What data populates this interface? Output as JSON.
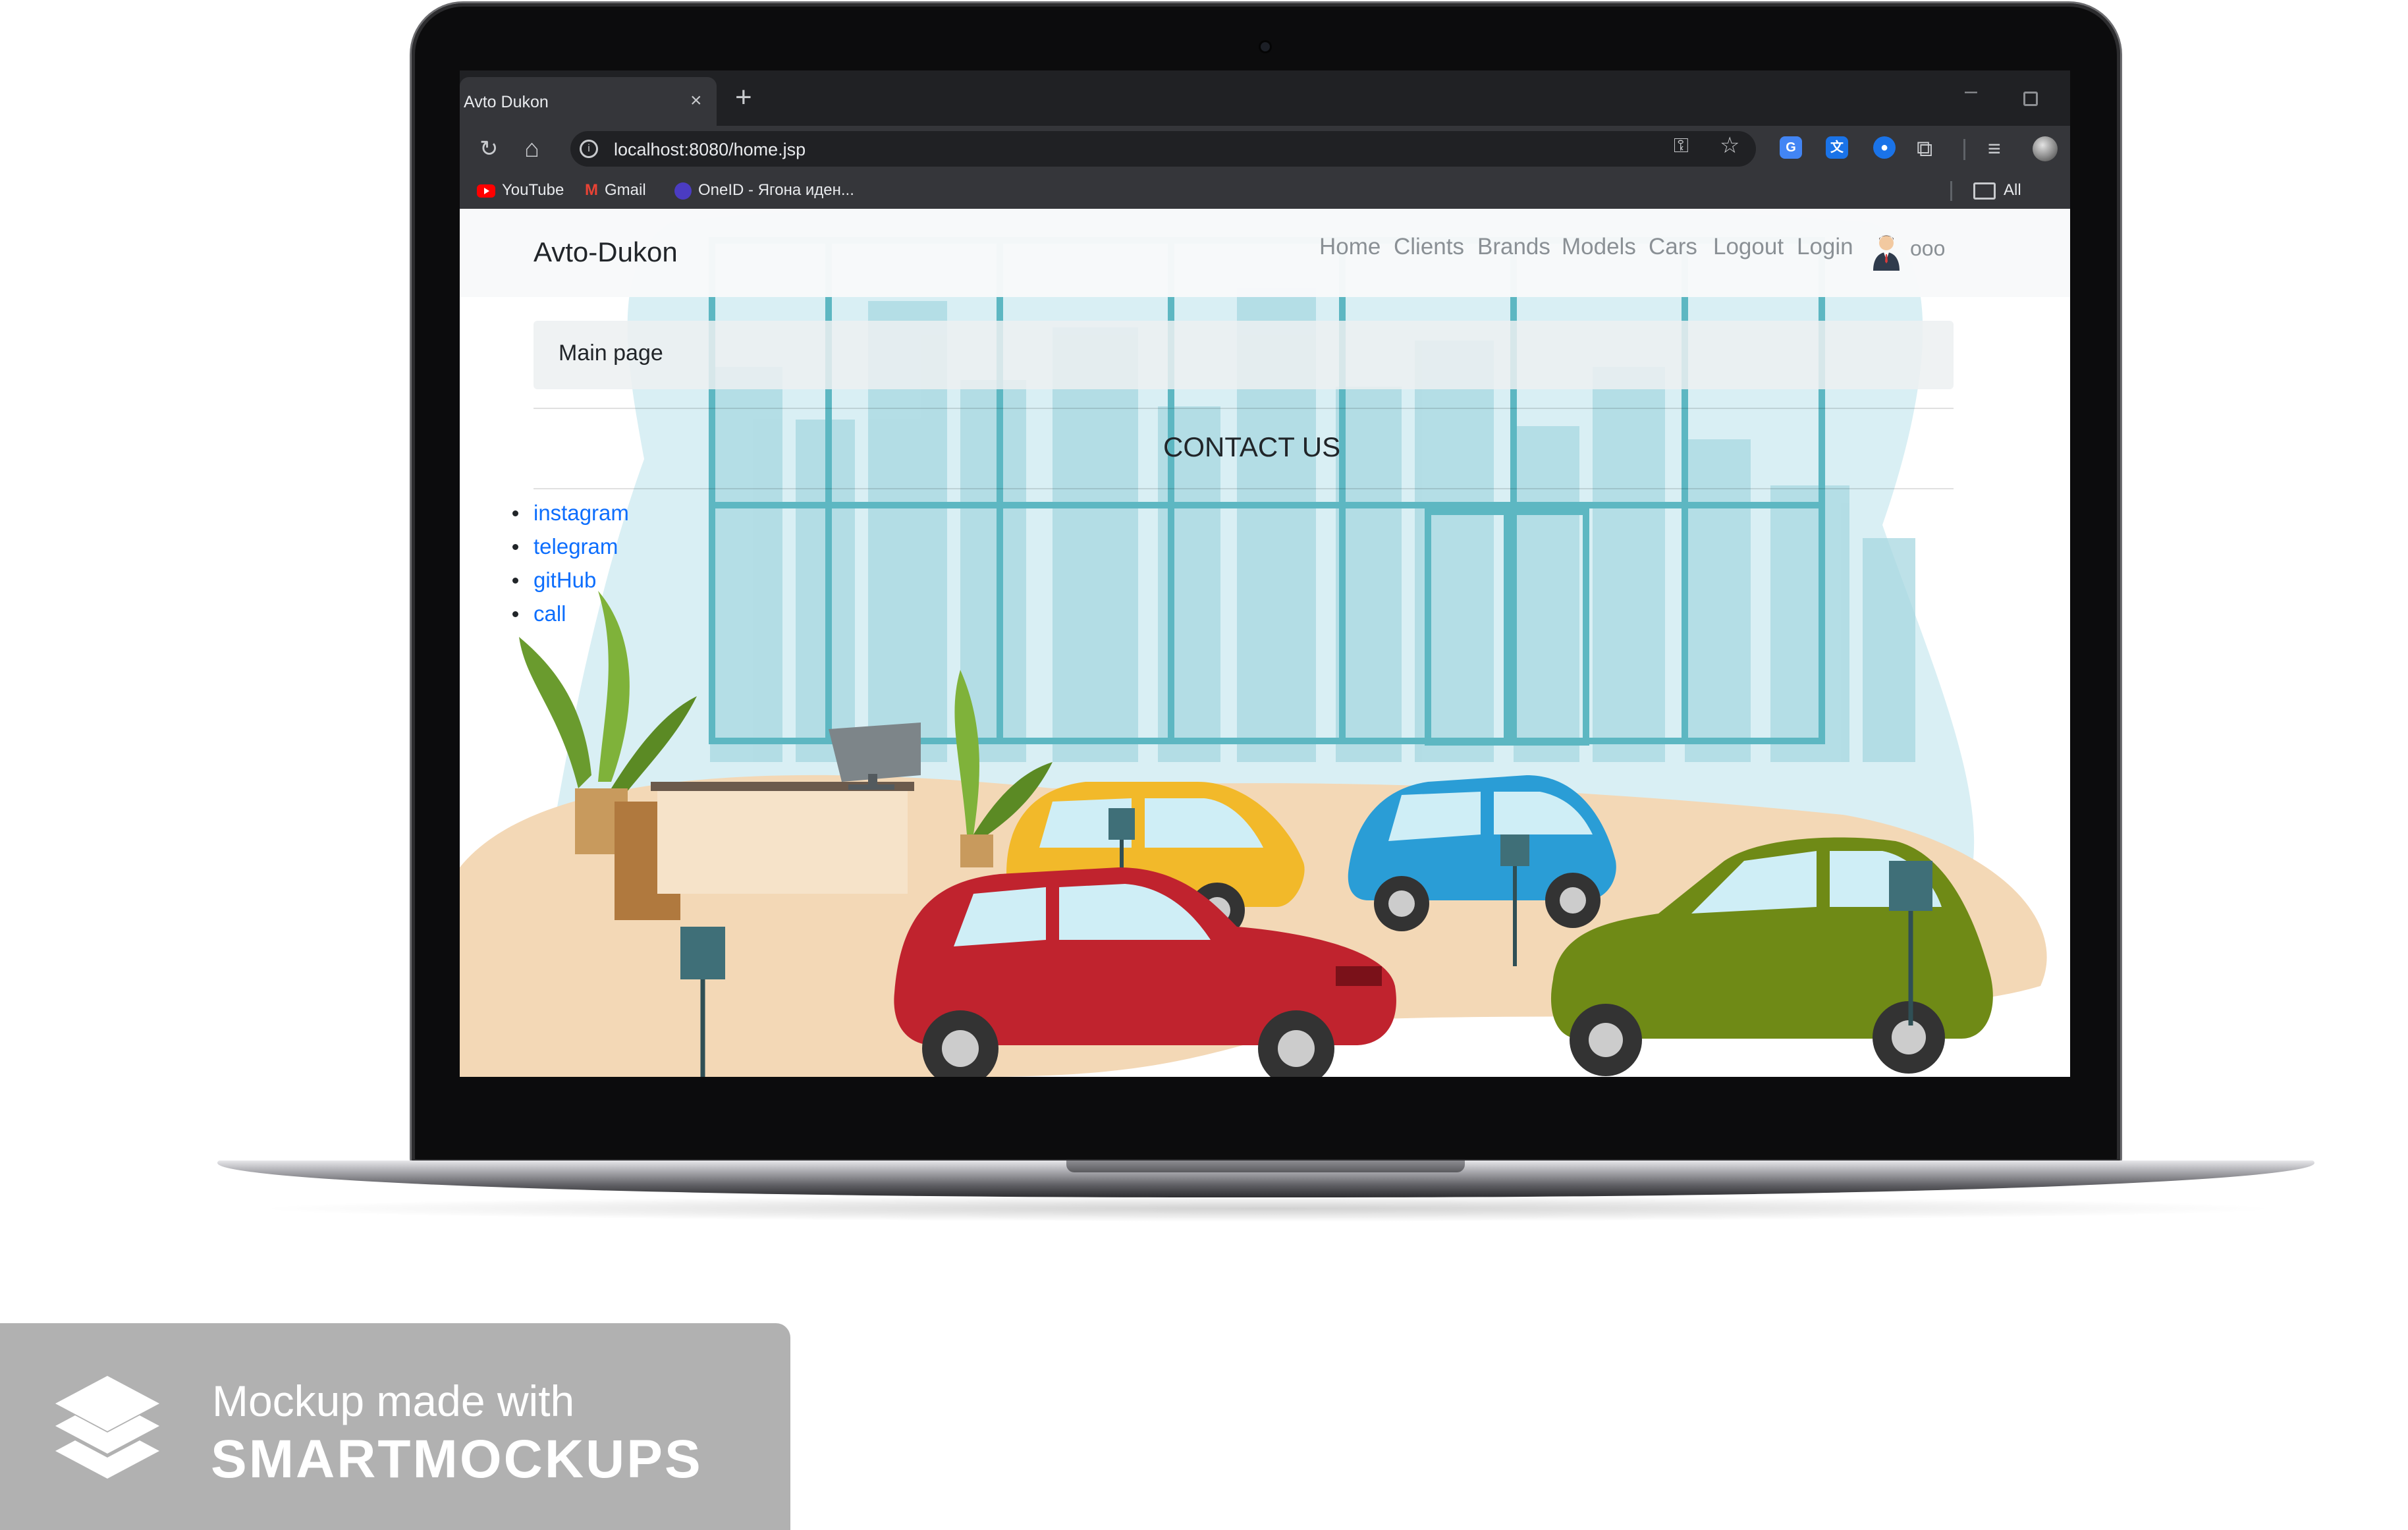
{
  "browser": {
    "tab_title": "Avto Dukon",
    "tab_close": "×",
    "new_tab": "+",
    "minimize": "–",
    "url": "localhost:8080/home.jsp",
    "reload_icon": "↻",
    "home_icon": "⌂",
    "key_icon": "⚿",
    "star_icon": "☆",
    "puzzle_icon": "⧉",
    "menu_icon": "≡",
    "bookmarks": [
      {
        "label": "YouTube"
      },
      {
        "label": "Gmail"
      },
      {
        "label": "OneID - Ягона иден..."
      },
      {
        "label": "All Bookm"
      }
    ]
  },
  "navbar": {
    "brand": "Avto-Dukon",
    "links": [
      "Home",
      "Clients",
      "Brands",
      "Models",
      "Cars",
      "Logout",
      "Login"
    ],
    "user": "ooo"
  },
  "breadcrumb": {
    "text": "Main page"
  },
  "contact": {
    "heading": "CONTACT US",
    "items": [
      "instagram",
      "telegram",
      "gitHub",
      "call"
    ]
  },
  "watermark": {
    "line1": "Mockup made with",
    "line2": "SMARTMOCKUPS"
  },
  "colors": {
    "browser_dark": "#202124",
    "browser_toolbar": "#35363a",
    "link_blue": "#0d6efd",
    "nav_gray": "#8a9095",
    "car_red": "#c0232e",
    "car_yellow": "#f2b92a",
    "car_blue": "#2a9dd6",
    "car_green": "#6f8a16"
  }
}
